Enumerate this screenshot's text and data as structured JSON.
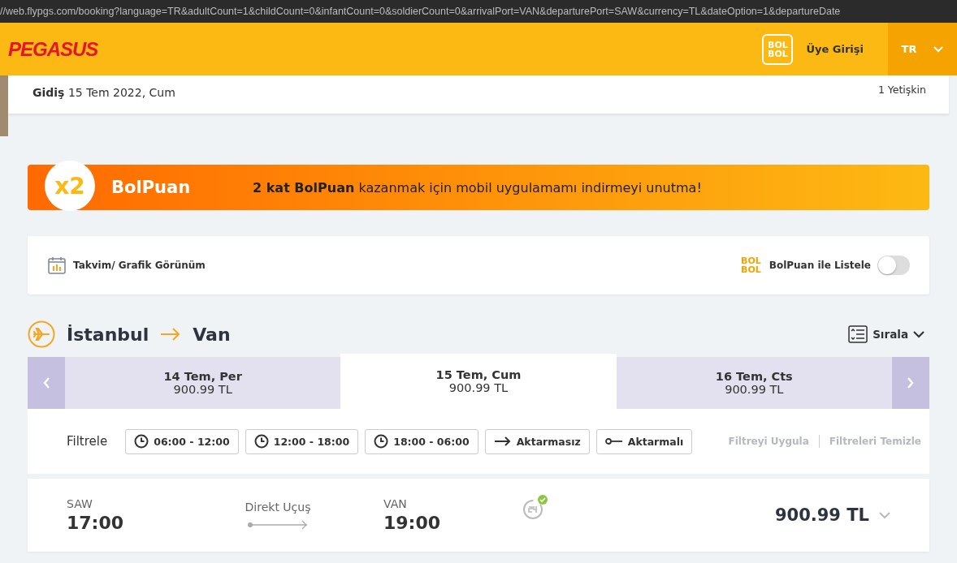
{
  "address_bar": {
    "url": "//web.flypgs.com/booking?language=TR&adultCount=1&childCount=0&infantCount=0&soldierCount=0&arrivalPort=VAN&departurePort=SAW&currency=TL&dateOption=1&departureDate"
  },
  "header": {
    "logo": "PEGASUS",
    "bolbol_logo": [
      "BOL",
      "BOL"
    ],
    "login": "Üye Girişi",
    "language": "TR"
  },
  "summary": {
    "label": "Gidiş",
    "date": "15 Tem 2022, Cum",
    "passengers": "1 Yetişkin"
  },
  "promo": {
    "badge": "x2",
    "title": "BolPuan",
    "message": "**2 kat BolPuan** kazanmak için mobil uygulamamı indirmeyi unutma!"
  },
  "options": {
    "calendar_view": "Takvim/ Grafik Görünüm",
    "bolbol_logo": [
      "BOL",
      "BOL"
    ],
    "bolpuan_list": "BolPuan ile Listele",
    "bolpuan_on": false
  },
  "route": {
    "from": "İstanbul",
    "to": "Van",
    "sort": "Sırala"
  },
  "dates": [
    {
      "date": "14 Tem, Per",
      "price": "900.99 TL",
      "selected": false
    },
    {
      "date": "15 Tem, Cum",
      "price": "900.99 TL",
      "selected": true
    },
    {
      "date": "16 Tem, Cts",
      "price": "900.99 TL",
      "selected": false
    }
  ],
  "filters": {
    "label": "Filtrele",
    "buttons": [
      {
        "kind": "time",
        "label": "06:00 - 12:00"
      },
      {
        "kind": "time",
        "label": "12:00 - 18:00"
      },
      {
        "kind": "time",
        "label": "18:00 - 06:00"
      },
      {
        "kind": "direct",
        "label": "Aktarmasız"
      },
      {
        "kind": "transfer",
        "label": "Aktarmalı"
      }
    ],
    "actions": [
      {
        "label": "Filtreyi Uygula",
        "disabled": true
      },
      {
        "label": "Filtreleri Temizle",
        "disabled": true
      }
    ]
  },
  "flight": {
    "from_code": "SAW",
    "departure": "17:00",
    "type": "Direkt Uçuş",
    "to_code": "VAN",
    "arrival": "19:00",
    "price": "900.99 TL"
  }
}
